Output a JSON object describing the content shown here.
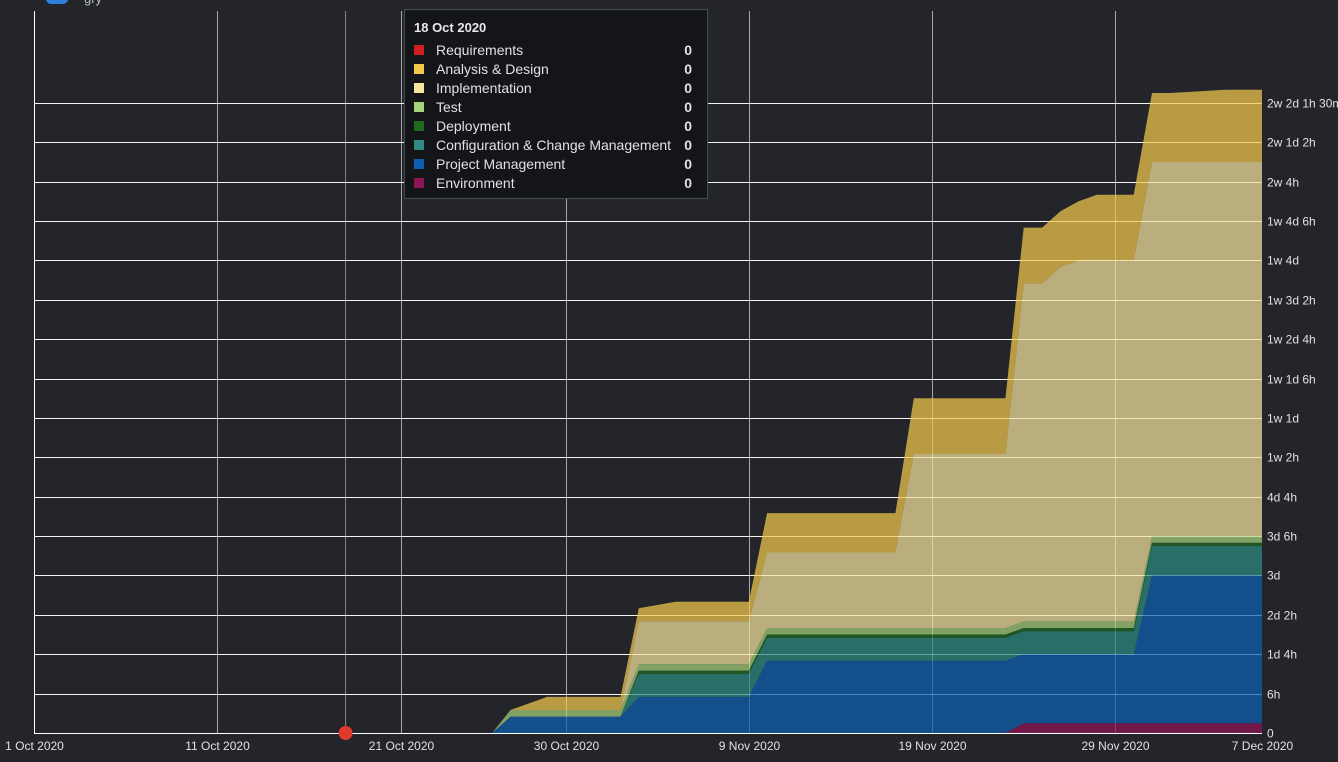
{
  "header": {
    "title_fragment": "gry"
  },
  "tooltip": {
    "title": "18 Oct 2020",
    "rows": [
      {
        "name": "Requirements",
        "value": "0",
        "color": "#d01f1f"
      },
      {
        "name": "Analysis & Design",
        "value": "0",
        "color": "#f2c94c"
      },
      {
        "name": "Implementation",
        "value": "0",
        "color": "#f5e3a0"
      },
      {
        "name": "Test",
        "value": "0",
        "color": "#a6d27b"
      },
      {
        "name": "Deployment",
        "value": "0",
        "color": "#1e6a1e"
      },
      {
        "name": "Configuration & Change Management",
        "value": "0",
        "color": "#2e8b84"
      },
      {
        "name": "Project Management",
        "value": "0",
        "color": "#0d5fb1"
      },
      {
        "name": "Environment",
        "value": "0",
        "color": "#8f1455"
      }
    ]
  },
  "chart_data": {
    "type": "area",
    "stacked": true,
    "x_unit": "date",
    "y_unit": "hours (8h day, 5d week)",
    "xlim": [
      "2020-10-01",
      "2020-12-07"
    ],
    "ylim": [
      0,
      110
    ],
    "grid": true,
    "legend": "tooltip",
    "x_ticks": [
      {
        "date": "2020-10-01",
        "label": "1 Oct 2020"
      },
      {
        "date": "2020-10-11",
        "label": "11 Oct 2020"
      },
      {
        "date": "2020-10-21",
        "label": "21 Oct 2020"
      },
      {
        "date": "2020-10-30",
        "label": "30 Oct 2020"
      },
      {
        "date": "2020-11-09",
        "label": "9 Nov 2020"
      },
      {
        "date": "2020-11-19",
        "label": "19 Nov 2020"
      },
      {
        "date": "2020-11-29",
        "label": "29 Nov 2020"
      },
      {
        "date": "2020-12-07",
        "label": "7 Dec 2020"
      }
    ],
    "y_ticks": [
      {
        "value": 0,
        "label": "0"
      },
      {
        "value": 6,
        "label": "6h"
      },
      {
        "value": 12,
        "label": "1d 4h"
      },
      {
        "value": 18,
        "label": "2d 2h"
      },
      {
        "value": 24,
        "label": "3d"
      },
      {
        "value": 30,
        "label": "3d 6h"
      },
      {
        "value": 36,
        "label": "4d 4h"
      },
      {
        "value": 42,
        "label": "1w 2h"
      },
      {
        "value": 48,
        "label": "1w 1d"
      },
      {
        "value": 54,
        "label": "1w 1d 6h"
      },
      {
        "value": 60,
        "label": "1w 2d 4h"
      },
      {
        "value": 66,
        "label": "1w 3d 2h"
      },
      {
        "value": 72,
        "label": "1w 4d"
      },
      {
        "value": 78,
        "label": "1w 4d 6h"
      },
      {
        "value": 84,
        "label": "2w 4h"
      },
      {
        "value": 90,
        "label": "2w 1d 2h"
      },
      {
        "value": 96,
        "label": "2w 2d 1h 30m"
      }
    ],
    "marker": {
      "date": "2020-10-18",
      "color": "#e03a2c"
    },
    "dates": [
      "2020-10-01",
      "2020-10-26",
      "2020-10-27",
      "2020-10-29",
      "2020-11-02",
      "2020-11-03",
      "2020-11-05",
      "2020-11-09",
      "2020-11-10",
      "2020-11-11",
      "2020-11-12",
      "2020-11-17",
      "2020-11-18",
      "2020-11-23",
      "2020-11-24",
      "2020-11-25",
      "2020-11-26",
      "2020-11-27",
      "2020-11-28",
      "2020-11-30",
      "2020-12-01",
      "2020-12-02",
      "2020-12-05",
      "2020-12-07"
    ],
    "series": [
      {
        "name": "Environment",
        "color": "#8f1455",
        "values": [
          0,
          0,
          0,
          0,
          0,
          0,
          0,
          0,
          0,
          0,
          0,
          0,
          0,
          0,
          1.5,
          1.5,
          1.5,
          1.5,
          1.5,
          1.5,
          1.5,
          1.5,
          1.5,
          1.5
        ]
      },
      {
        "name": "Project Management",
        "color": "#0d5fb1",
        "values": [
          0,
          0,
          2.5,
          2.5,
          2.5,
          5.5,
          5.5,
          5.5,
          11,
          11,
          11,
          11,
          11,
          11,
          10.5,
          10.5,
          10.5,
          10.5,
          10.5,
          10.5,
          22.5,
          22.5,
          22.5,
          22.5
        ]
      },
      {
        "name": "Configuration & Change Management",
        "color": "#2e8b84",
        "values": [
          0,
          0,
          0,
          0,
          0,
          3.5,
          3.5,
          3.5,
          3.5,
          3.5,
          3.5,
          3.5,
          3.5,
          3.5,
          3.5,
          3.5,
          3.5,
          3.5,
          3.5,
          3.5,
          4.5,
          4.5,
          4.5,
          4.5
        ]
      },
      {
        "name": "Deployment",
        "color": "#1e6a1e",
        "values": [
          0,
          0,
          0,
          0,
          0,
          0.5,
          0.5,
          0.5,
          0.5,
          0.5,
          0.5,
          0.5,
          0.5,
          0.5,
          0.5,
          0.5,
          0.5,
          0.5,
          0.5,
          0.5,
          0.5,
          0.5,
          0.5,
          0.5
        ]
      },
      {
        "name": "Test",
        "color": "#a6d27b",
        "values": [
          0,
          0,
          1,
          1,
          1,
          1,
          1,
          1,
          1,
          1,
          1,
          1,
          1,
          1,
          1,
          1,
          1,
          1,
          1,
          1,
          1,
          1,
          1,
          1
        ]
      },
      {
        "name": "Implementation",
        "color": "#f5e3a0",
        "values": [
          0,
          0,
          0,
          0,
          0,
          6.5,
          6.5,
          6.5,
          11.5,
          11.5,
          11.5,
          11.5,
          26.5,
          26.5,
          51.5,
          51.5,
          54,
          55,
          55,
          55,
          57,
          57,
          57,
          57
        ]
      },
      {
        "name": "Analysis & Design",
        "color": "#f2c94c",
        "values": [
          0,
          0,
          0,
          2,
          2,
          2,
          3,
          3,
          6,
          6,
          6,
          6,
          8.5,
          8.5,
          8.5,
          8.5,
          8.5,
          9,
          10,
          10,
          10.5,
          10.5,
          11,
          11
        ]
      },
      {
        "name": "Requirements",
        "color": "#d01f1f",
        "values": [
          0,
          0,
          0,
          0,
          0,
          0,
          0,
          0,
          0,
          0,
          0,
          0,
          0,
          0,
          0,
          0,
          0,
          0,
          0,
          0,
          0,
          0,
          0,
          0
        ]
      }
    ]
  }
}
